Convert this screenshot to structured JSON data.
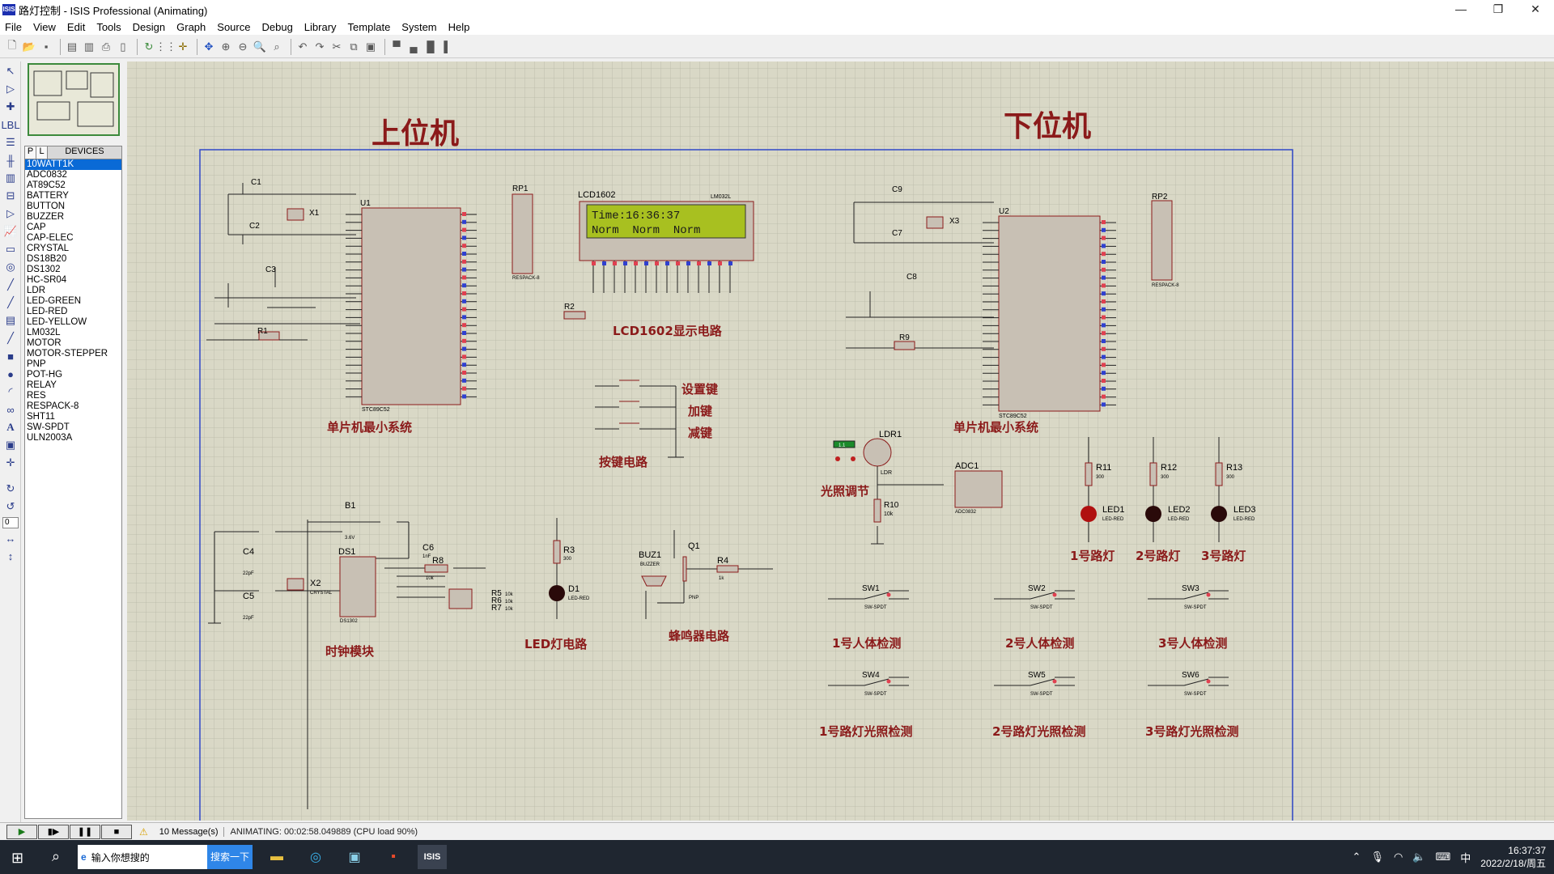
{
  "window": {
    "title": "路灯控制 - ISIS Professional (Animating)",
    "app_icon": "ISIS",
    "minimize": "—",
    "maximize": "❐",
    "close": "✕"
  },
  "menu": [
    "File",
    "View",
    "Edit",
    "Tools",
    "Design",
    "Graph",
    "Source",
    "Debug",
    "Library",
    "Template",
    "System",
    "Help"
  ],
  "devices": {
    "tab_p": "P",
    "tab_l": "L",
    "header": "DEVICES",
    "selected": "10WATT1K",
    "items": [
      "10WATT1K",
      "ADC0832",
      "AT89C52",
      "BATTERY",
      "BUTTON",
      "BUZZER",
      "CAP",
      "CAP-ELEC",
      "CRYSTAL",
      "DS18B20",
      "DS1302",
      "HC-SR04",
      "LDR",
      "LED-GREEN",
      "LED-RED",
      "LED-YELLOW",
      "LM032L",
      "MOTOR",
      "MOTOR-STEPPER",
      "PNP",
      "POT-HG",
      "RELAY",
      "RES",
      "RESPACK-8",
      "SHT11",
      "SW-SPDT",
      "ULN2003A"
    ]
  },
  "rotation_value": "0",
  "schematic": {
    "section_upper": "上位机",
    "section_lower": "下位机",
    "labels": {
      "mcu_left": "单片机最小系统",
      "mcu_right": "单片机最小系统",
      "lcd_circuit": "LCD1602显示电路",
      "set_key": "设置键",
      "add_key": "加键",
      "sub_key": "减键",
      "key_circuit": "按键电路",
      "light_adjust": "光照调节",
      "lamp1": "1号路灯",
      "lamp2": "2号路灯",
      "lamp3": "3号路灯",
      "clock_module": "时钟模块",
      "led_circuit": "LED灯电路",
      "buzzer_circuit": "蜂鸣器电路",
      "body1": "1号人体检测",
      "body2": "2号人体检测",
      "body3": "3号人体检测",
      "light1": "1号路灯光照检测",
      "light2": "2号路灯光照检测",
      "light3": "3号路灯光照检测"
    },
    "lcd": {
      "name": "LCD1602",
      "part": "LM032L",
      "line1": "Time:16:36:37",
      "line2": "Norm  Norm  Norm"
    },
    "parts": {
      "U1": "U1",
      "U2": "U2",
      "mcu_type": "STC89C52",
      "RP1": "RP1",
      "RP2": "RP2",
      "respack": "RESPACK-8",
      "C1": "C1",
      "C2": "C2",
      "C3": "C3",
      "R1": "R1",
      "R2": "R2",
      "X1": "X1",
      "C9": "C9",
      "C7": "C7",
      "C8": "C8",
      "R9": "R9",
      "X3": "X3",
      "LDR1": "LDR1",
      "LDR": "LDR",
      "ldr_meter": "1.1",
      "ADC1": "ADC1",
      "adc_type": "ADC0832",
      "R10": "R10",
      "R10_val": "10k",
      "R11": "R11",
      "R12": "R12",
      "R13": "R13",
      "r300": "300",
      "LED1": "LED1",
      "LED2": "LED2",
      "LED3": "LED3",
      "led_red": "LED-RED",
      "B1": "B1",
      "B1_val": "3.6V",
      "DS1": "DS1",
      "ds_type": "DS1302",
      "C4": "C4",
      "C5": "C5",
      "c22": "22pF",
      "C6": "C6",
      "C6_val": "1nF",
      "X2": "X2",
      "crystal": "CRYSTAL",
      "R8": "R8",
      "r10k": "10k",
      "R5": "R5",
      "R6": "R6",
      "R7": "R7",
      "R3": "R3",
      "D1": "D1",
      "BUZ1": "BUZ1",
      "buzzer": "BUZZER",
      "Q1": "Q1",
      "pnp": "PNP",
      "R4": "R4",
      "R4_val": "1k",
      "SW1": "SW1",
      "SW2": "SW2",
      "SW3": "SW3",
      "SW4": "SW4",
      "SW5": "SW5",
      "SW6": "SW6",
      "swspdt": "SW-SPDT"
    }
  },
  "status": {
    "messages": "10 Message(s)",
    "animating": "ANIMATING: 00:02:58.049889 (CPU load 90%)",
    "play": "▶",
    "step": "▮▶",
    "pause": "❚❚",
    "stop": "■"
  },
  "taskbar": {
    "search_placeholder": "输入你想搜的",
    "search_button": "搜索一下",
    "time": "16:37:37",
    "date": "2022/2/18/周五",
    "ime": "中"
  },
  "colors": {
    "canvas": "#d9d8c6",
    "sheet_border": "#3048c8",
    "label_red": "#8b1a1a",
    "component": "#8b1a1a",
    "lcd_screen": "#a8c020",
    "selection": "#0a6ad6"
  }
}
